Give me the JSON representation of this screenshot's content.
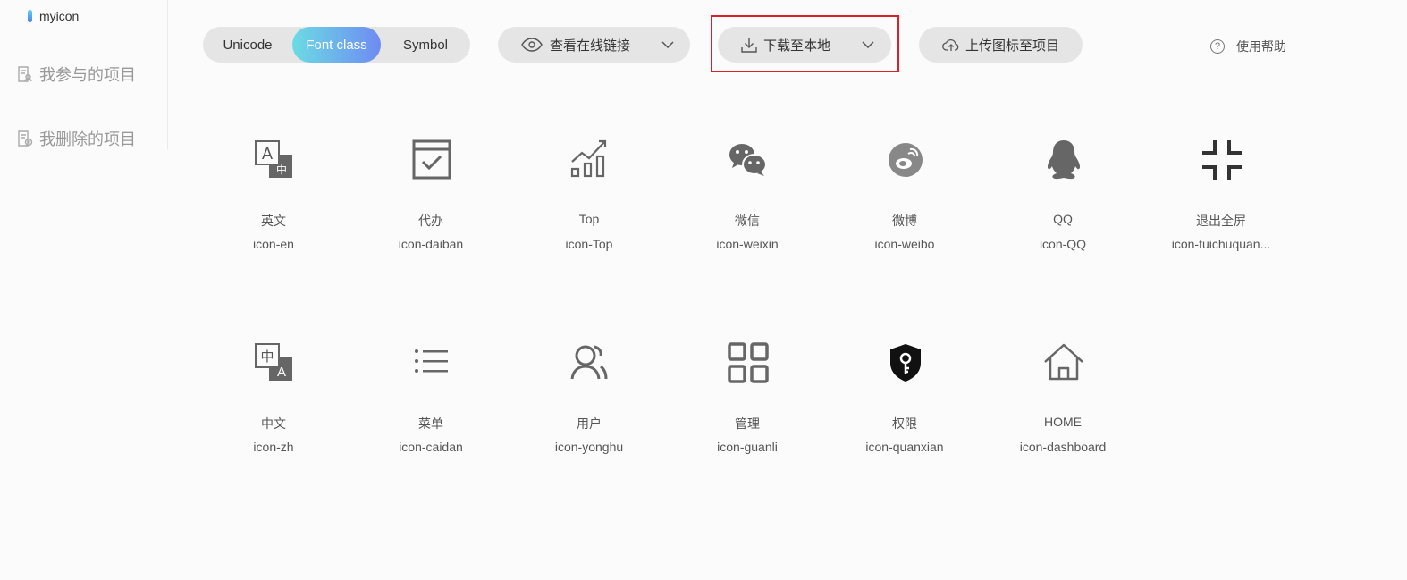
{
  "sidebar": {
    "project_name": "myicon",
    "links": [
      {
        "label": "我参与的项目"
      },
      {
        "label": "我删除的项目"
      }
    ]
  },
  "toolbar": {
    "segments": [
      "Unicode",
      "Font class",
      "Symbol"
    ],
    "active_segment": "Font class",
    "view_link_label": "查看在线链接",
    "download_label": "下载至本地",
    "upload_label": "上传图标至项目",
    "help_label": "使用帮助",
    "help_symbol": "?"
  },
  "icons": [
    {
      "name": "英文",
      "class": "icon-en",
      "icon": "translate-en-icon"
    },
    {
      "name": "代办",
      "class": "icon-daiban",
      "icon": "todo-check-icon"
    },
    {
      "name": "Top",
      "class": "icon-Top",
      "icon": "trend-chart-icon"
    },
    {
      "name": "微信",
      "class": "icon-weixin",
      "icon": "wechat-icon"
    },
    {
      "name": "微博",
      "class": "icon-weibo",
      "icon": "weibo-icon"
    },
    {
      "name": "QQ",
      "class": "icon-QQ",
      "icon": "qq-icon"
    },
    {
      "name": "退出全屏",
      "class": "icon-tuichuquan...",
      "icon": "exit-fullscreen-icon"
    },
    {
      "name": "中文",
      "class": "icon-zh",
      "icon": "translate-zh-icon"
    },
    {
      "name": "菜单",
      "class": "icon-caidan",
      "icon": "menu-list-icon"
    },
    {
      "name": "用户",
      "class": "icon-yonghu",
      "icon": "user-icon"
    },
    {
      "name": "管理",
      "class": "icon-guanli",
      "icon": "grid-manage-icon"
    },
    {
      "name": "权限",
      "class": "icon-quanxian",
      "icon": "shield-key-icon"
    },
    {
      "name": "HOME",
      "class": "icon-dashboard",
      "icon": "home-icon"
    }
  ],
  "glyph_text": {
    "en_big": "A",
    "en_small": "中",
    "zh_big": "中",
    "zh_small": "A"
  },
  "colors": {
    "accent_gradient_start": "#6bdbe4",
    "accent_gradient_end": "#6e8bf2",
    "highlight_border": "#d9212c",
    "icon_color": "#666666"
  }
}
